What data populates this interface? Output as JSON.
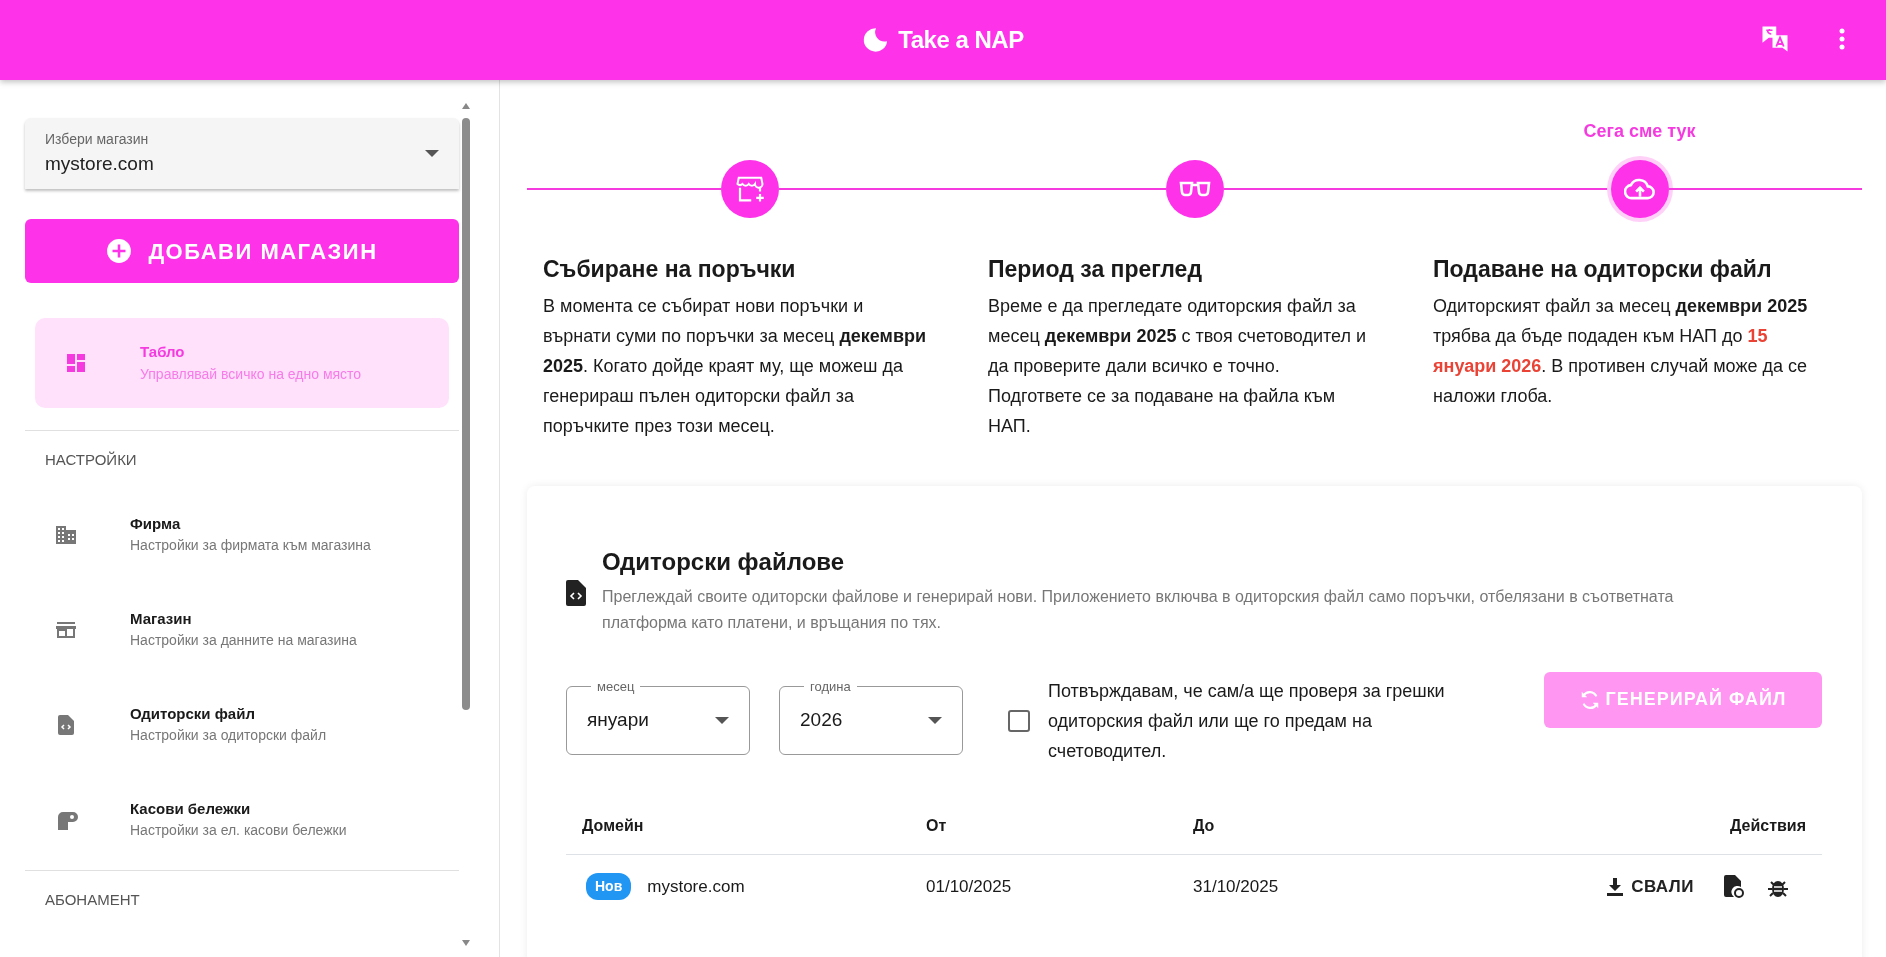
{
  "header": {
    "logo_text": "Take a NAP"
  },
  "sidebar": {
    "store_select": {
      "label": "Избери магазин",
      "value": "mystore.com"
    },
    "add_button": {
      "label": "ДОБАВИ МАГАЗИН"
    },
    "nav": [
      {
        "kind": "item",
        "title": "Табло",
        "subtitle": "Управлявай всичко на едно място",
        "selected": true
      },
      {
        "kind": "section",
        "label": "НАСТРОЙКИ"
      },
      {
        "kind": "item",
        "title": "Фирма",
        "subtitle": "Настройки за фирмата към магазина",
        "selected": false
      },
      {
        "kind": "item",
        "title": "Магазин",
        "subtitle": "Настройки за данните на магазина",
        "selected": false
      },
      {
        "kind": "item",
        "title": "Одиторски файл",
        "subtitle": "Настройки за одиторски файл",
        "selected": false
      },
      {
        "kind": "item",
        "title": "Касови бележки",
        "subtitle": "Настройки за ел. касови бележки",
        "selected": false
      },
      {
        "kind": "section",
        "label": "АБОНАМЕНТ"
      }
    ]
  },
  "stepper": {
    "current_label": "Сега сме тук",
    "steps": [
      {
        "title": "Събиране на поръчки",
        "current": false,
        "body": [
          {
            "text": "В момента се събират нови поръчки и върнати суми по поръчки за месец ",
            "kind": "plain"
          },
          {
            "text": "декември 2025",
            "kind": "bold"
          },
          {
            "text": ". Когато дойде краят му, ще можеш да генерираш пълен одиторски файл за поръчките през този месец.",
            "kind": "plain"
          }
        ]
      },
      {
        "title": "Период за преглед",
        "current": false,
        "body": [
          {
            "text": "Време е да прегледате одиторския файл за месец ",
            "kind": "plain"
          },
          {
            "text": "декември 2025",
            "kind": "bold"
          },
          {
            "text": " с твоя счетоводител и да проверите дали всичко е точно. Подгответе се за подаване на файла към НАП.",
            "kind": "plain"
          }
        ]
      },
      {
        "title": "Подаване на одиторски файл",
        "current": true,
        "body": [
          {
            "text": "Одиторският файл за месец ",
            "kind": "plain"
          },
          {
            "text": "декември 2025",
            "kind": "bold"
          },
          {
            "text": " трябва да бъде подаден към НАП до ",
            "kind": "plain"
          },
          {
            "text": "15 януари 2026",
            "kind": "alert"
          },
          {
            "text": ". В противен случай може да се наложи глоба.",
            "kind": "plain"
          }
        ]
      }
    ]
  },
  "audit_files": {
    "title": "Одиторски файлове",
    "description": "Преглеждай своите одиторски файлове и генерирай нови. Приложението включва в одиторския файл само поръчки, отбелязани в съответната платформа като платени, и връщания по тях.",
    "month_select": {
      "label": "месец",
      "value": "януари"
    },
    "year_select": {
      "label": "година",
      "value": "2026"
    },
    "confirm": {
      "label": "Потвърждавам, че сам/а ще проверя за грешки одиторския файл или ще го предам на счетоводител.",
      "checked": false
    },
    "generate_button": {
      "label": "ГЕНЕРИРАЙ ФАЙЛ",
      "disabled": true
    },
    "table": {
      "columns": [
        "Домейн",
        "От",
        "До",
        "Действия"
      ],
      "rows": [
        {
          "badge": "Нов",
          "domain": "mystore.com",
          "from": "01/10/2025",
          "to": "31/10/2025",
          "download_label": "СВАЛИ"
        }
      ]
    }
  }
}
